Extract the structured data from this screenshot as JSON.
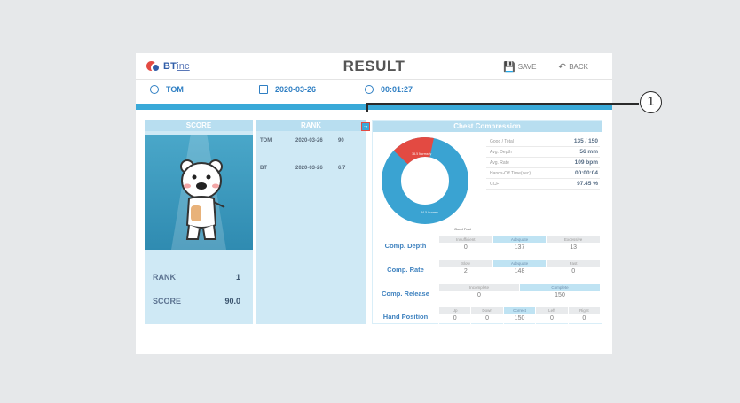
{
  "app": {
    "logo": {
      "brand": "BT",
      "suffix": "inc"
    },
    "title": "RESULT",
    "save_label": "SAVE",
    "back_label": "BACK"
  },
  "info": {
    "user": "TOM",
    "date": "2020-03-26",
    "time": "00:01:27"
  },
  "score_panel": {
    "header": "SCORE",
    "rank_label": "RANK",
    "rank_value": "1",
    "score_label": "SCORE",
    "score_value": "90.0"
  },
  "rank_panel": {
    "header": "RANK",
    "rows": [
      {
        "name": "TOM",
        "date": "2020-03-26",
        "score": "90"
      },
      {
        "name": "BT",
        "date": "2020-03-26",
        "score": "6.7"
      }
    ]
  },
  "chest": {
    "header": "Chest Compression",
    "donut": {
      "segment_red_label": "18.5 Normally",
      "segment_blue_label": "84.5 Scorers",
      "legend": "Good Fast",
      "red_fraction": 0.16
    },
    "stats": [
      {
        "key": "Good / Total",
        "value": "135 / 150"
      },
      {
        "key": "Avg. Depth",
        "value": "56 mm"
      },
      {
        "key": "Avg. Rate",
        "value": "109 bpm"
      },
      {
        "key": "Hands-Off Time(sec)",
        "value": "00:00:04"
      },
      {
        "key": "CCF",
        "value": "97.45 %"
      }
    ],
    "metrics": [
      {
        "label": "Comp. Depth",
        "cells": [
          {
            "h": "Insufficient",
            "v": "0"
          },
          {
            "h": "Adequate",
            "v": "137",
            "hl": true
          },
          {
            "h": "Excessive",
            "v": "13"
          }
        ]
      },
      {
        "label": "Comp. Rate",
        "cells": [
          {
            "h": "Slow",
            "v": "2"
          },
          {
            "h": "Adequate",
            "v": "148",
            "hl": true
          },
          {
            "h": "Fast",
            "v": "0"
          }
        ]
      },
      {
        "label": "Comp. Release",
        "cells": [
          {
            "h": "Incomplete",
            "v": "0"
          },
          {
            "h": "Complete",
            "v": "150",
            "hl": true
          }
        ]
      },
      {
        "label": "Hand Position",
        "cells": [
          {
            "h": "Up",
            "v": "0"
          },
          {
            "h": "Down",
            "v": "0"
          },
          {
            "h": "Correct",
            "v": "150",
            "hl": true
          },
          {
            "h": "Left",
            "v": "0"
          },
          {
            "h": "Right",
            "v": "0"
          }
        ]
      }
    ]
  },
  "callout": {
    "number": "1"
  },
  "colors": {
    "accent": "#39a9d8",
    "panel": "#cfe9f5",
    "red": "#e34a42"
  }
}
